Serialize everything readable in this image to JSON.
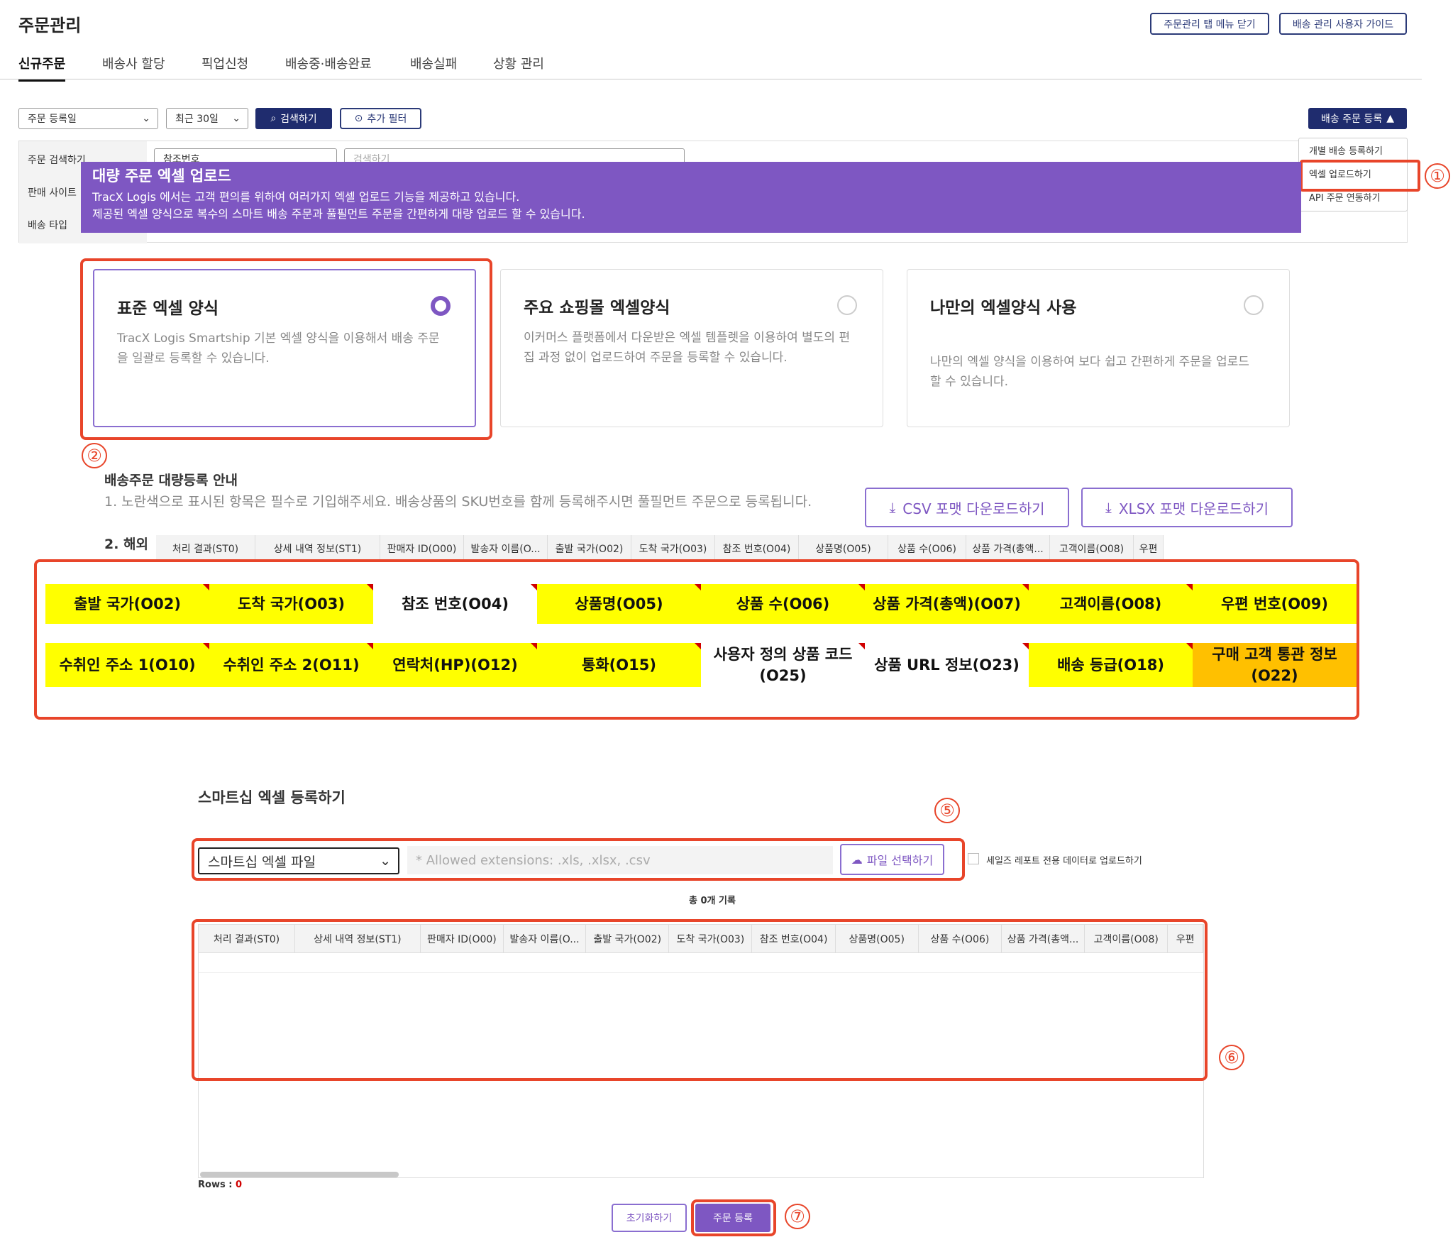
{
  "page": {
    "title": "주문관리",
    "close_tab_label": "주문관리 탭 메뉴 닫기",
    "guide_label": "배송 관리 사용자 가이드"
  },
  "tabs": [
    {
      "label": "신규주문",
      "active": true
    },
    {
      "label": "배송사 할당"
    },
    {
      "label": "픽업신청"
    },
    {
      "label": "배송중·배송완료"
    },
    {
      "label": "배송실패"
    },
    {
      "label": "상황 관리"
    }
  ],
  "filters": {
    "date_type": "주문 등록일",
    "period": "최근 30일",
    "search_label": "검색하기",
    "add_filter_label": "추가 필터",
    "register_label": "배송 주문 등록"
  },
  "search_panel": {
    "row1_label": "주문 검색하기",
    "row1_select": "참조번호",
    "row1_placeholder": "검색하기",
    "row2_label": "판매 사이트",
    "row3_label": "배송 타입"
  },
  "dropdown": {
    "items": [
      "개별 배송 등록하기",
      "엑셀 업로드하기",
      "API 주문 연동하기"
    ]
  },
  "banner": {
    "title": "대량 주문 엑셀 업로드",
    "line1": "TracX Logis 에서는 고객 편의를 위하여 여러가지 엑셀 업로드 기능을 제공하고 있습니다.",
    "line2": "제공된 엑셀 양식으로 복수의 스마트 배송 주문과 풀필먼트 주문을 간편하게 대량 업로드 할 수 있습니다."
  },
  "cards": [
    {
      "title": "표준 엑셀 양식",
      "desc": "TracX Logis Smartship 기본 엑셀 양식을 이용해서 배송 주문을 일괄로 등록할 수 있습니다.",
      "selected": true
    },
    {
      "title": "주요 쇼핑몰 엑셀양식",
      "desc": "이커머스 플랫폼에서 다운받은 엑셀 템플렛을 이용하여 별도의 편집 과정 없이 업로드하여 주문을 등록할 수 있습니다.",
      "selected": false
    },
    {
      "title": "나만의 엑셀양식 사용",
      "desc": "나만의 엑셀 양식을 이용하여 보다 쉽고 간편하게 주문을 업로드 할 수 있습니다.",
      "selected": false
    }
  ],
  "guide": {
    "heading": "배송주문 대량등록 안내",
    "line1": "1. 노란색으로 표시된 항목은 필수로 기입해주세요. 배송상품의 SKU번호를 함께 등록해주시면 풀필먼트 주문으로 등록됩니다.",
    "line2": "2. 해외",
    "csv_label": "CSV 포맷 다운로드하기",
    "xlsx_label": "XLSX 포맷 다운로드하기"
  },
  "template_headers": [
    "처리 결과(ST0)",
    "상세 내역 정보(ST1)",
    "판매자 ID(O00)",
    "발송자 이름(O...",
    "출발 국가(O02)",
    "도착 국가(O03)",
    "참조 번호(O04)",
    "상품명(O05)",
    "상품 수(O06)",
    "상품 가격(총액...",
    "고객이름(O08)",
    "우편"
  ],
  "fields_row1": [
    {
      "label": "출발 국가(O02)",
      "color": "yellow"
    },
    {
      "label": "도착 국가(O03)",
      "color": "yellow"
    },
    {
      "label": "참조 번호(O04)",
      "color": "white"
    },
    {
      "label": "상품명(O05)",
      "color": "yellow"
    },
    {
      "label": "상품 수(O06)",
      "color": "yellow"
    },
    {
      "label": "상품 가격(총액)(O07)",
      "color": "yellow"
    },
    {
      "label": "고객이름(O08)",
      "color": "yellow"
    },
    {
      "label": "우편 번호(O09)",
      "color": "yellow"
    }
  ],
  "fields_row2": [
    {
      "label": "수취인 주소 1(O10)",
      "color": "yellow"
    },
    {
      "label": "수취인 주소 2(O11)",
      "color": "yellow"
    },
    {
      "label": "연락처(HP)(O12)",
      "color": "yellow"
    },
    {
      "label": "통화(O15)",
      "color": "yellow"
    },
    {
      "label": "사용자 정의 상품 코드(O25)",
      "color": "white"
    },
    {
      "label": "상품 URL 정보(O23)",
      "color": "white"
    },
    {
      "label": "배송 등급(O18)",
      "color": "yellow"
    },
    {
      "label": "구매 고객 통관 정보(O22)",
      "color": "orange"
    }
  ],
  "upload": {
    "heading": "스마트십 엑셀 등록하기",
    "file_type": "스마트십 엑셀 파일",
    "placeholder": "* Allowed extensions: .xls, .xlsx, .csv",
    "choose_label": "파일 선택하기",
    "sales_report_label": "세일즈 레포트 전용 데이터로 업로드하기",
    "total_label": "총 0개 기록",
    "rows_label": "Rows : ",
    "rows_value": "0"
  },
  "result_headers": [
    "처리 결과(ST0)",
    "상세 내역 정보(ST1)",
    "판매자 ID(O00)",
    "발송자 이름(O...",
    "출발 국가(O02)",
    "도착 국가(O03)",
    "참조 번호(O04)",
    "상품명(O05)",
    "상품 수(O06)",
    "상품 가격(총액...",
    "고객이름(O08)",
    "우편"
  ],
  "footer": {
    "reset_label": "초기화하기",
    "submit_label": "주문 등록"
  },
  "markers": [
    "①",
    "②",
    "⑤",
    "⑥",
    "⑦"
  ],
  "colors": {
    "accent": "#7e57c2",
    "navy": "#1f2c6e",
    "highlight": "#e8452a",
    "required": "#ffff00",
    "optional_orange": "#ffc000"
  }
}
